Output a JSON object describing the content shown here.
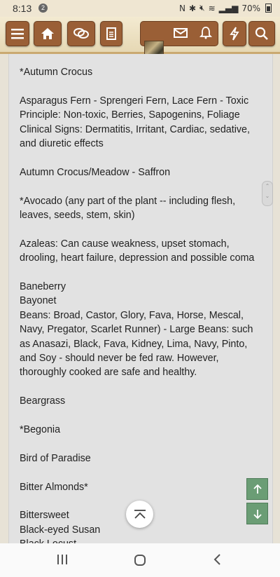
{
  "status_bar": {
    "time": "8:13",
    "notification_count": "2",
    "battery": "70%"
  },
  "header": {
    "buttons": [
      "menu-icon",
      "home-icon",
      "chat-icon",
      "document-icon",
      "mail-icon",
      "bell-icon",
      "lightning-icon",
      "search-icon"
    ]
  },
  "content": {
    "paragraphs": [
      "*Autumn Crocus",
      "Asparagus Fern - Sprengeri Fern, Lace Fern - Toxic Principle: Non-toxic, Berries, Sapogenins, Foliage Clinical Signs: Dermatitis, Irritant, Cardiac, sedative, and diuretic effects",
      "Autumn Crocus/Meadow - Saffron",
      "*Avocado (any part of the plant -- including flesh, leaves, seeds, stem, skin)",
      "Azaleas: Can cause weakness, upset stomach, drooling, heart failure, depression and possible coma",
      "Baneberry",
      "Bayonet",
      "Beans: Broad, Castor, Glory, Fava, Horse, Mescal, Navy, Pregator, Scarlet Runner) - Large Beans: such as Anasazi, Black, Fava, Kidney, Lima, Navy, Pinto, and Soy - should never be fed raw. However, thoroughly cooked are safe and healthy.",
      "Beargrass",
      "*Begonia",
      "Bird of Paradise",
      "Bitter Almonds*",
      "Bittersweet",
      "Black-eyed Susan",
      "Black Locust"
    ]
  },
  "colors": {
    "nav_brown": "#9a5f36",
    "arrow_green": "#6b9d75",
    "page_bg": "#e2e2e2"
  }
}
